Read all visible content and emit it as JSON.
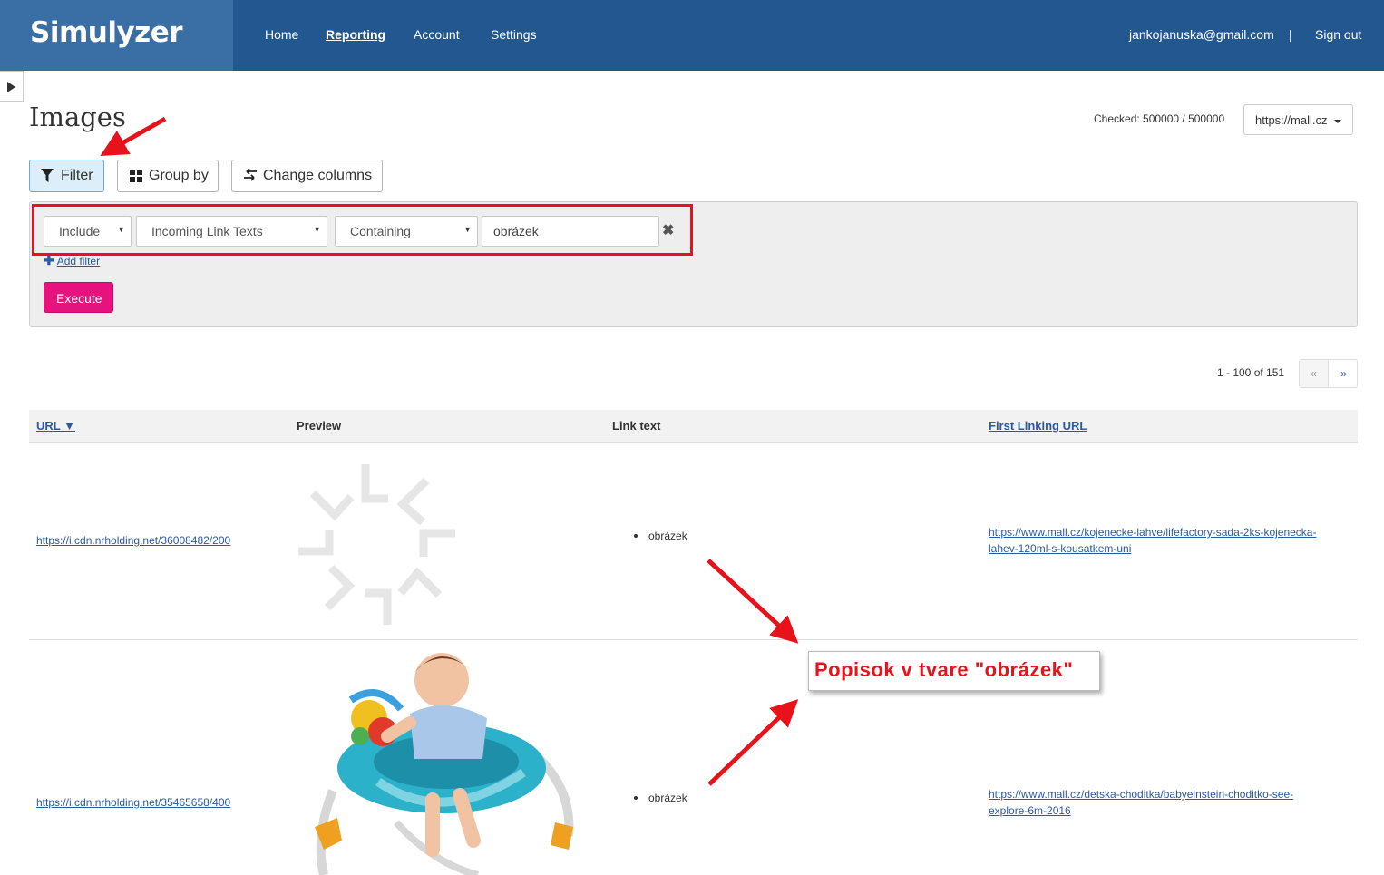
{
  "app": {
    "brand": "Simulyzer",
    "nav": [
      "Home",
      "Reporting",
      "Account",
      "Settings"
    ],
    "active_nav": "Reporting",
    "user_email": "jankojanuska@gmail.com",
    "separator": "|",
    "sign_out": "Sign out"
  },
  "page": {
    "title": "Images",
    "checked": "Checked: 500000 / 500000",
    "domain": "https://mall.cz"
  },
  "toolbar": {
    "filter_label": "Filter",
    "groupby_label": "Group by",
    "change_columns_label": "Change columns"
  },
  "filter": {
    "mode": "Include",
    "field": "Incoming Link Texts",
    "operator": "Containing",
    "value": "obrázek",
    "remove_symbol": "✖",
    "add_filter": "Add filter",
    "execute": "Execute"
  },
  "pagination": {
    "summary": "1 - 100 of 151",
    "prev": "«",
    "next": "»"
  },
  "table": {
    "columns": [
      "URL ▼",
      "Preview",
      "Link text",
      "First Linking URL"
    ],
    "rows": [
      {
        "url": "https://i.cdn.nrholding.net/36008482/200",
        "link_text": "obrázek",
        "first_linking_url_1": "https://www.mall.cz/kojenecke-lahve/lifefactory-sada-2ks-kojenecka-",
        "first_linking_url_2": "lahev-120ml-s-kousatkem-uni"
      },
      {
        "url": "https://i.cdn.nrholding.net/35465658/400",
        "link_text": "obrázek",
        "first_linking_url_1": "https://www.mall.cz/detska-choditka/babyeinstein-choditko-see-",
        "first_linking_url_2": "explore-6m-2016"
      }
    ]
  },
  "annotation": {
    "callout_text": "Popisok v tvare \"obrázek\"",
    "color": "#e8121b"
  },
  "colors": {
    "nav_bg": "#22578f",
    "brand_bg": "#3a6fa5",
    "execute_bg": "#e6137f",
    "link": "#2a5aa0"
  }
}
